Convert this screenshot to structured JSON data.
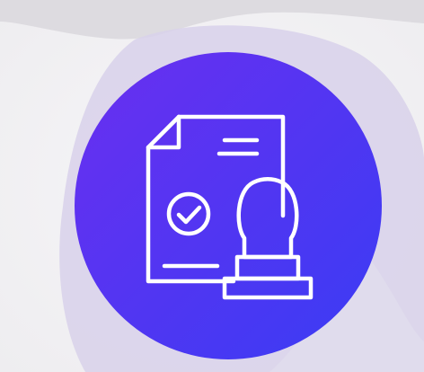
{
  "illustration": {
    "icon": "document-approval-stamp-icon",
    "colors": {
      "badge_gradient_start": "#6a2ff0",
      "badge_gradient_end": "#3a3cf4",
      "background_light": "#f3f2f4",
      "background_lilac": "#d6cfe9",
      "background_gray": "#dcdbdf",
      "icon_stroke": "#ffffff"
    }
  }
}
